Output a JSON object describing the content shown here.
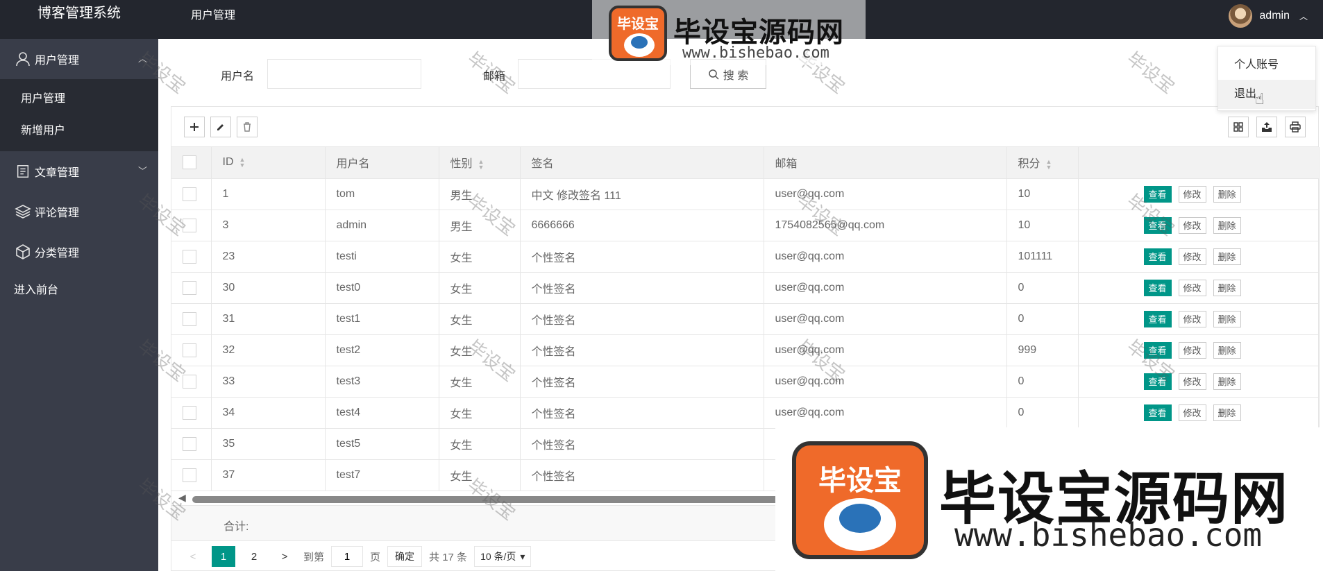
{
  "app": {
    "title": "博客管理系统"
  },
  "header": {
    "crumb": "用户管理",
    "user": "admin"
  },
  "sidebar": {
    "items": [
      {
        "label": "用户管理",
        "icon": "user-icon",
        "expanded": true,
        "sub": [
          {
            "label": "用户管理"
          },
          {
            "label": "新增用户"
          }
        ]
      },
      {
        "label": "文章管理",
        "icon": "document-icon"
      },
      {
        "label": "评论管理",
        "icon": "layers-icon"
      },
      {
        "label": "分类管理",
        "icon": "cube-icon"
      }
    ],
    "frontend": "进入前台"
  },
  "search": {
    "username_label": "用户名",
    "email_label": "邮箱",
    "username_value": "",
    "email_value": "",
    "button": "搜 索"
  },
  "dropdown": {
    "items": [
      "个人账号",
      "退出"
    ]
  },
  "table": {
    "columns": [
      "ID",
      "用户名",
      "性别",
      "签名",
      "邮箱",
      "积分"
    ],
    "actions": {
      "view": "查看",
      "edit": "修改",
      "delete": "删除"
    },
    "rows": [
      {
        "id": "1",
        "username": "tom",
        "gender": "男生",
        "signature": "中文 修改签名 111",
        "email": "user@qq.com",
        "score": "10"
      },
      {
        "id": "3",
        "username": "admin",
        "gender": "男生",
        "signature": "6666666",
        "email": "1754082565@qq.com",
        "score": "10"
      },
      {
        "id": "23",
        "username": "testi",
        "gender": "女生",
        "signature": "个性签名",
        "email": "user@qq.com",
        "score": "101111"
      },
      {
        "id": "30",
        "username": "test0",
        "gender": "女生",
        "signature": "个性签名",
        "email": "user@qq.com",
        "score": "0"
      },
      {
        "id": "31",
        "username": "test1",
        "gender": "女生",
        "signature": "个性签名",
        "email": "user@qq.com",
        "score": "0"
      },
      {
        "id": "32",
        "username": "test2",
        "gender": "女生",
        "signature": "个性签名",
        "email": "user@qq.com",
        "score": "999"
      },
      {
        "id": "33",
        "username": "test3",
        "gender": "女生",
        "signature": "个性签名",
        "email": "user@qq.com",
        "score": "0"
      },
      {
        "id": "34",
        "username": "test4",
        "gender": "女生",
        "signature": "个性签名",
        "email": "user@qq.com",
        "score": "0"
      },
      {
        "id": "35",
        "username": "test5",
        "gender": "女生",
        "signature": "个性签名",
        "email": "",
        "score": ""
      },
      {
        "id": "37",
        "username": "test7",
        "gender": "女生",
        "signature": "个性签名",
        "email": "",
        "score": ""
      }
    ],
    "total_label": "合计:"
  },
  "pager": {
    "pages": [
      "1",
      "2"
    ],
    "goto_label": "到第",
    "goto_value": "1",
    "page_label": "页",
    "confirm": "确定",
    "total": "共 17 条",
    "per_page": "10 条/页"
  },
  "watermark": {
    "text": "毕设宝",
    "brand": "毕设宝源码网",
    "url": "www.bishebao.com",
    "logo_text": "毕设宝"
  },
  "colors": {
    "primary": "#009688",
    "sidebar": "#393d49",
    "header": "#23262e",
    "brand_orange": "#ef6a2a"
  }
}
